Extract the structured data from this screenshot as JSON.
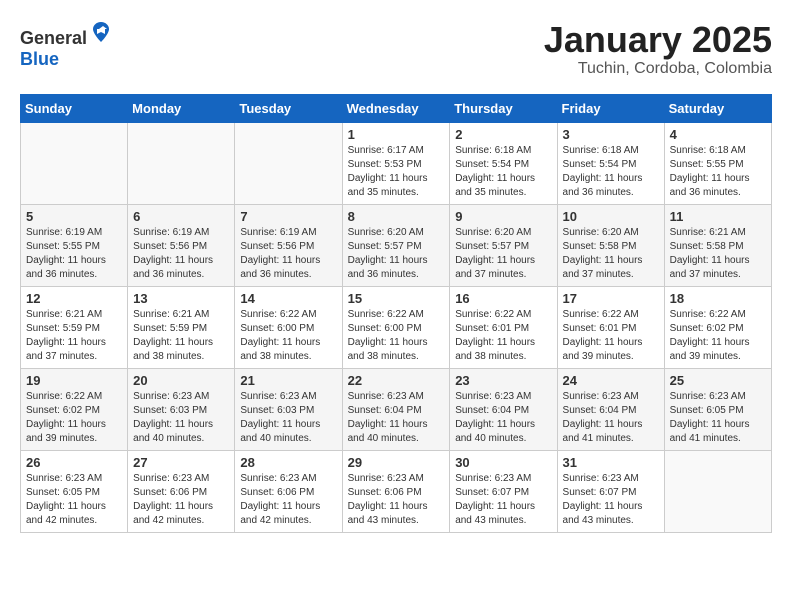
{
  "header": {
    "logo_general": "General",
    "logo_blue": "Blue",
    "month_title": "January 2025",
    "location": "Tuchin, Cordoba, Colombia"
  },
  "weekdays": [
    "Sunday",
    "Monday",
    "Tuesday",
    "Wednesday",
    "Thursday",
    "Friday",
    "Saturday"
  ],
  "weeks": [
    [
      {
        "day": "",
        "sunrise": "",
        "sunset": "",
        "daylight": ""
      },
      {
        "day": "",
        "sunrise": "",
        "sunset": "",
        "daylight": ""
      },
      {
        "day": "",
        "sunrise": "",
        "sunset": "",
        "daylight": ""
      },
      {
        "day": "1",
        "sunrise": "Sunrise: 6:17 AM",
        "sunset": "Sunset: 5:53 PM",
        "daylight": "Daylight: 11 hours and 35 minutes."
      },
      {
        "day": "2",
        "sunrise": "Sunrise: 6:18 AM",
        "sunset": "Sunset: 5:54 PM",
        "daylight": "Daylight: 11 hours and 35 minutes."
      },
      {
        "day": "3",
        "sunrise": "Sunrise: 6:18 AM",
        "sunset": "Sunset: 5:54 PM",
        "daylight": "Daylight: 11 hours and 36 minutes."
      },
      {
        "day": "4",
        "sunrise": "Sunrise: 6:18 AM",
        "sunset": "Sunset: 5:55 PM",
        "daylight": "Daylight: 11 hours and 36 minutes."
      }
    ],
    [
      {
        "day": "5",
        "sunrise": "Sunrise: 6:19 AM",
        "sunset": "Sunset: 5:55 PM",
        "daylight": "Daylight: 11 hours and 36 minutes."
      },
      {
        "day": "6",
        "sunrise": "Sunrise: 6:19 AM",
        "sunset": "Sunset: 5:56 PM",
        "daylight": "Daylight: 11 hours and 36 minutes."
      },
      {
        "day": "7",
        "sunrise": "Sunrise: 6:19 AM",
        "sunset": "Sunset: 5:56 PM",
        "daylight": "Daylight: 11 hours and 36 minutes."
      },
      {
        "day": "8",
        "sunrise": "Sunrise: 6:20 AM",
        "sunset": "Sunset: 5:57 PM",
        "daylight": "Daylight: 11 hours and 36 minutes."
      },
      {
        "day": "9",
        "sunrise": "Sunrise: 6:20 AM",
        "sunset": "Sunset: 5:57 PM",
        "daylight": "Daylight: 11 hours and 37 minutes."
      },
      {
        "day": "10",
        "sunrise": "Sunrise: 6:20 AM",
        "sunset": "Sunset: 5:58 PM",
        "daylight": "Daylight: 11 hours and 37 minutes."
      },
      {
        "day": "11",
        "sunrise": "Sunrise: 6:21 AM",
        "sunset": "Sunset: 5:58 PM",
        "daylight": "Daylight: 11 hours and 37 minutes."
      }
    ],
    [
      {
        "day": "12",
        "sunrise": "Sunrise: 6:21 AM",
        "sunset": "Sunset: 5:59 PM",
        "daylight": "Daylight: 11 hours and 37 minutes."
      },
      {
        "day": "13",
        "sunrise": "Sunrise: 6:21 AM",
        "sunset": "Sunset: 5:59 PM",
        "daylight": "Daylight: 11 hours and 38 minutes."
      },
      {
        "day": "14",
        "sunrise": "Sunrise: 6:22 AM",
        "sunset": "Sunset: 6:00 PM",
        "daylight": "Daylight: 11 hours and 38 minutes."
      },
      {
        "day": "15",
        "sunrise": "Sunrise: 6:22 AM",
        "sunset": "Sunset: 6:00 PM",
        "daylight": "Daylight: 11 hours and 38 minutes."
      },
      {
        "day": "16",
        "sunrise": "Sunrise: 6:22 AM",
        "sunset": "Sunset: 6:01 PM",
        "daylight": "Daylight: 11 hours and 38 minutes."
      },
      {
        "day": "17",
        "sunrise": "Sunrise: 6:22 AM",
        "sunset": "Sunset: 6:01 PM",
        "daylight": "Daylight: 11 hours and 39 minutes."
      },
      {
        "day": "18",
        "sunrise": "Sunrise: 6:22 AM",
        "sunset": "Sunset: 6:02 PM",
        "daylight": "Daylight: 11 hours and 39 minutes."
      }
    ],
    [
      {
        "day": "19",
        "sunrise": "Sunrise: 6:22 AM",
        "sunset": "Sunset: 6:02 PM",
        "daylight": "Daylight: 11 hours and 39 minutes."
      },
      {
        "day": "20",
        "sunrise": "Sunrise: 6:23 AM",
        "sunset": "Sunset: 6:03 PM",
        "daylight": "Daylight: 11 hours and 40 minutes."
      },
      {
        "day": "21",
        "sunrise": "Sunrise: 6:23 AM",
        "sunset": "Sunset: 6:03 PM",
        "daylight": "Daylight: 11 hours and 40 minutes."
      },
      {
        "day": "22",
        "sunrise": "Sunrise: 6:23 AM",
        "sunset": "Sunset: 6:04 PM",
        "daylight": "Daylight: 11 hours and 40 minutes."
      },
      {
        "day": "23",
        "sunrise": "Sunrise: 6:23 AM",
        "sunset": "Sunset: 6:04 PM",
        "daylight": "Daylight: 11 hours and 40 minutes."
      },
      {
        "day": "24",
        "sunrise": "Sunrise: 6:23 AM",
        "sunset": "Sunset: 6:04 PM",
        "daylight": "Daylight: 11 hours and 41 minutes."
      },
      {
        "day": "25",
        "sunrise": "Sunrise: 6:23 AM",
        "sunset": "Sunset: 6:05 PM",
        "daylight": "Daylight: 11 hours and 41 minutes."
      }
    ],
    [
      {
        "day": "26",
        "sunrise": "Sunrise: 6:23 AM",
        "sunset": "Sunset: 6:05 PM",
        "daylight": "Daylight: 11 hours and 42 minutes."
      },
      {
        "day": "27",
        "sunrise": "Sunrise: 6:23 AM",
        "sunset": "Sunset: 6:06 PM",
        "daylight": "Daylight: 11 hours and 42 minutes."
      },
      {
        "day": "28",
        "sunrise": "Sunrise: 6:23 AM",
        "sunset": "Sunset: 6:06 PM",
        "daylight": "Daylight: 11 hours and 42 minutes."
      },
      {
        "day": "29",
        "sunrise": "Sunrise: 6:23 AM",
        "sunset": "Sunset: 6:06 PM",
        "daylight": "Daylight: 11 hours and 43 minutes."
      },
      {
        "day": "30",
        "sunrise": "Sunrise: 6:23 AM",
        "sunset": "Sunset: 6:07 PM",
        "daylight": "Daylight: 11 hours and 43 minutes."
      },
      {
        "day": "31",
        "sunrise": "Sunrise: 6:23 AM",
        "sunset": "Sunset: 6:07 PM",
        "daylight": "Daylight: 11 hours and 43 minutes."
      },
      {
        "day": "",
        "sunrise": "",
        "sunset": "",
        "daylight": ""
      }
    ]
  ]
}
